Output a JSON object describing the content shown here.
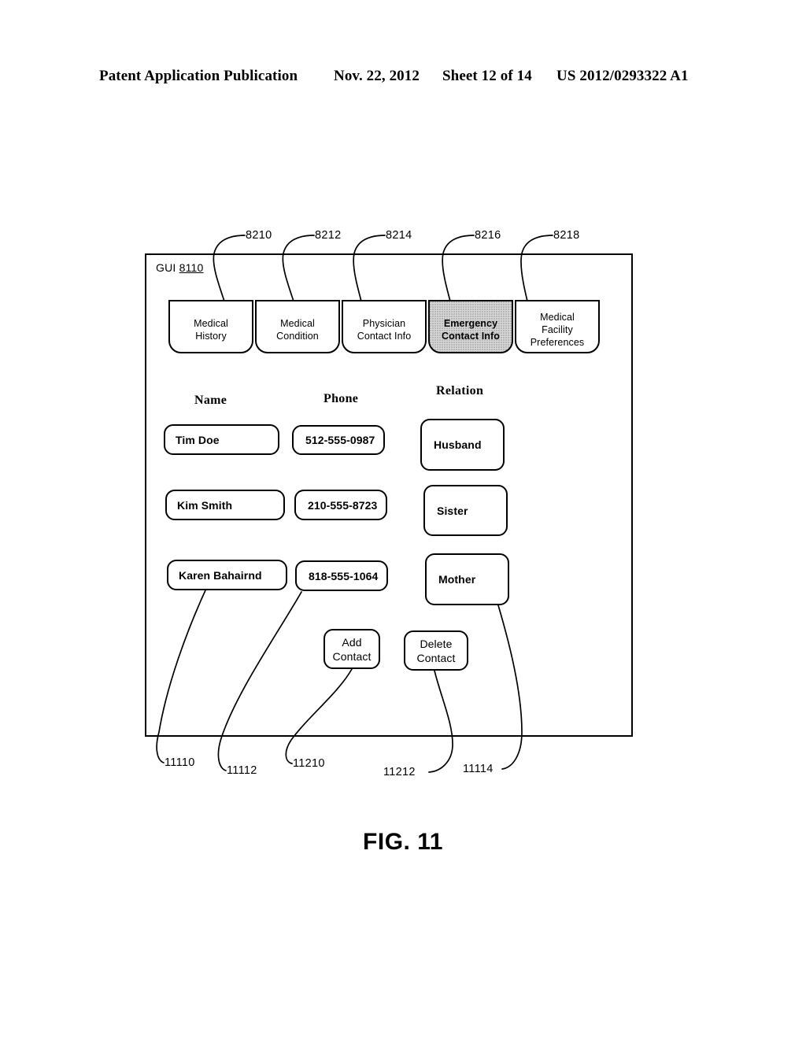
{
  "page_header": {
    "publication": "Patent Application Publication",
    "date": "Nov. 22, 2012",
    "sheet": "Sheet 12 of 14",
    "patent_number": "US 2012/0293322 A1"
  },
  "figure": {
    "caption": "FIG. 11"
  },
  "gui": {
    "label_prefix": "GUI ",
    "label_number": "8110"
  },
  "tabs": [
    {
      "id": "medical-history",
      "line1": "Medical",
      "line2": "History",
      "selected": false,
      "ref": "8210"
    },
    {
      "id": "medical-condition",
      "line1": "Medical",
      "line2": "Condition",
      "selected": false,
      "ref": "8212"
    },
    {
      "id": "physician-contact-info",
      "line1": "Physician",
      "line2": "Contact Info",
      "selected": false,
      "ref": "8214"
    },
    {
      "id": "emergency-contact-info",
      "line1": "Emergency",
      "line2": "Contact Info",
      "selected": true,
      "ref": "8216"
    },
    {
      "id": "medical-facility-preferences",
      "line1": "Medical",
      "line2": "Facility",
      "line3": "Preferences",
      "selected": false,
      "ref": "8218"
    }
  ],
  "columns": {
    "name": "Name",
    "phone": "Phone",
    "relation": "Relation"
  },
  "contacts": [
    {
      "name": "Tim Doe",
      "phone": "512-555-0987",
      "relation": "Husband"
    },
    {
      "name": "Kim Smith",
      "phone": "210-555-8723",
      "relation": "Sister"
    },
    {
      "name": "Karen Bahairnd",
      "phone": "818-555-1064",
      "relation": "Mother"
    }
  ],
  "buttons": {
    "add": {
      "line1": "Add",
      "line2": "Contact"
    },
    "delete": {
      "line1": "Delete",
      "line2": "Contact"
    }
  },
  "reference_numerals": {
    "name_field": "11110",
    "phone_field": "11112",
    "add_contact": "11210",
    "delete_contact": "11212",
    "relation_field": "11114"
  },
  "colors": {
    "ink": "#000000",
    "paper": "#ffffff",
    "selected_tab_fill": "#d8d8d8"
  }
}
